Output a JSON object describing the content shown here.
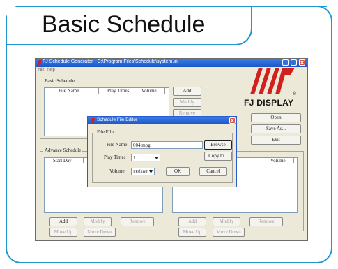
{
  "slide": {
    "title": "Basic Schedule"
  },
  "app": {
    "window_title": "FJ Schedule Generator - C:\\Program Files\\Schedule\\system.ini",
    "menu": [
      "File",
      "Help"
    ],
    "basic": {
      "legend": "Basic Schedule",
      "columns": [
        "File Name",
        "Play Times",
        "Volume"
      ],
      "buttons": {
        "add": "Add",
        "modify": "Modify",
        "remove": "Remove"
      }
    },
    "side_buttons": {
      "open": "Open",
      "save_as": "Save As...",
      "exit": "Exit"
    },
    "advance": {
      "legend": "Advance Schedule",
      "left_column": "Start Day",
      "right_column": "Volume",
      "left_buttons": {
        "add": "Add",
        "modify": "Modify",
        "remove": "Remove",
        "move_up": "Move Up",
        "move_down": "Move Down"
      },
      "right_buttons": {
        "add": "Add",
        "modify": "Modify",
        "remove": "Remove",
        "move_up": "Move Up",
        "move_down": "Move Down"
      }
    },
    "logo": {
      "text": "FJ DISPLAY",
      "registered": "®"
    }
  },
  "dialog": {
    "title": "Schedule File Editor",
    "legend": "File Edit",
    "file_name_label": "File Name",
    "file_name_value": "004.mpg",
    "browse": "Browse",
    "copy_to": "Copy to...",
    "play_times_label": "Play Times",
    "play_times_value": "1",
    "volume_label": "Volume",
    "volume_value": "Default",
    "ok": "OK",
    "cancel": "Cancel"
  },
  "colors": {
    "frame": "#1f97d4",
    "titlebar": "#1a55c7",
    "logo_red": "#d2201f"
  }
}
